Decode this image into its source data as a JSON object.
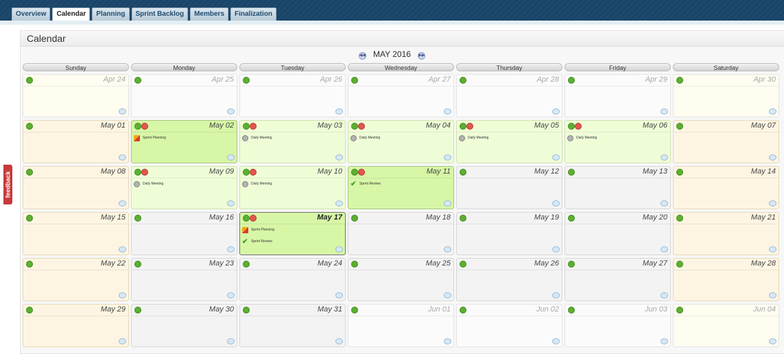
{
  "tabs": [
    {
      "label": "Overview",
      "active": false
    },
    {
      "label": "Calendar",
      "active": true
    },
    {
      "label": "Planning",
      "active": false
    },
    {
      "label": "Sprint Backlog",
      "active": false
    },
    {
      "label": "Members",
      "active": false
    },
    {
      "label": "Finalization",
      "active": false
    }
  ],
  "feedback_label": "feedback",
  "panel_title": "Calendar",
  "month_label": "MAY 2016",
  "weekdays": [
    "Sunday",
    "Monday",
    "Tuesday",
    "Wednesday",
    "Thursday",
    "Friday",
    "Saturday"
  ],
  "weeks": [
    [
      {
        "date": "Apr 24",
        "other_month": true
      },
      {
        "date": "Apr 25",
        "other_month": true
      },
      {
        "date": "Apr 26",
        "other_month": true
      },
      {
        "date": "Apr 27",
        "other_month": true
      },
      {
        "date": "Apr 28",
        "other_month": true
      },
      {
        "date": "Apr 29",
        "other_month": true
      },
      {
        "date": "Apr 30",
        "other_month": true
      }
    ],
    [
      {
        "date": "May 01"
      },
      {
        "date": "May 02",
        "highlight": "milestone",
        "removable": true,
        "events": [
          {
            "icon": "planning-icon",
            "label": "Sprint Planning"
          }
        ]
      },
      {
        "date": "May 03",
        "highlight": "sprint",
        "removable": true,
        "events": [
          {
            "icon": "meeting-icon",
            "label": "Daily Meeting"
          }
        ]
      },
      {
        "date": "May 04",
        "highlight": "sprint",
        "removable": true,
        "events": [
          {
            "icon": "meeting-icon",
            "label": "Daily Meeting"
          }
        ]
      },
      {
        "date": "May 05",
        "highlight": "sprint",
        "removable": true,
        "events": [
          {
            "icon": "meeting-icon",
            "label": "Daily Meeting"
          }
        ]
      },
      {
        "date": "May 06",
        "highlight": "sprint",
        "removable": true,
        "events": [
          {
            "icon": "meeting-icon",
            "label": "Daily Meeting"
          }
        ]
      },
      {
        "date": "May 07"
      }
    ],
    [
      {
        "date": "May 08"
      },
      {
        "date": "May 09",
        "highlight": "sprint",
        "removable": true,
        "events": [
          {
            "icon": "meeting-icon",
            "label": "Daily Meeting"
          }
        ]
      },
      {
        "date": "May 10",
        "highlight": "sprint",
        "removable": true,
        "events": [
          {
            "icon": "meeting-icon",
            "label": "Daily Meeting"
          }
        ]
      },
      {
        "date": "May 11",
        "highlight": "milestone",
        "removable": true,
        "events": [
          {
            "icon": "review-icon",
            "label": "Sprint Review"
          }
        ]
      },
      {
        "date": "May 12"
      },
      {
        "date": "May 13"
      },
      {
        "date": "May 14"
      }
    ],
    [
      {
        "date": "May 15"
      },
      {
        "date": "May 16"
      },
      {
        "date": "May 17",
        "highlight": "milestone",
        "today": true,
        "removable": true,
        "events": [
          {
            "icon": "planning-icon",
            "label": "Sprint Planning"
          },
          {
            "icon": "review-icon",
            "label": "Sprint Review"
          }
        ]
      },
      {
        "date": "May 18"
      },
      {
        "date": "May 19"
      },
      {
        "date": "May 20"
      },
      {
        "date": "May 21"
      }
    ],
    [
      {
        "date": "May 22"
      },
      {
        "date": "May 23"
      },
      {
        "date": "May 24"
      },
      {
        "date": "May 25"
      },
      {
        "date": "May 26"
      },
      {
        "date": "May 27"
      },
      {
        "date": "May 28"
      }
    ],
    [
      {
        "date": "May 29"
      },
      {
        "date": "May 30"
      },
      {
        "date": "May 31"
      },
      {
        "date": "Jun 01",
        "other_month": true
      },
      {
        "date": "Jun 02",
        "other_month": true
      },
      {
        "date": "Jun 03",
        "other_month": true
      },
      {
        "date": "Jun 04",
        "other_month": true
      }
    ]
  ]
}
